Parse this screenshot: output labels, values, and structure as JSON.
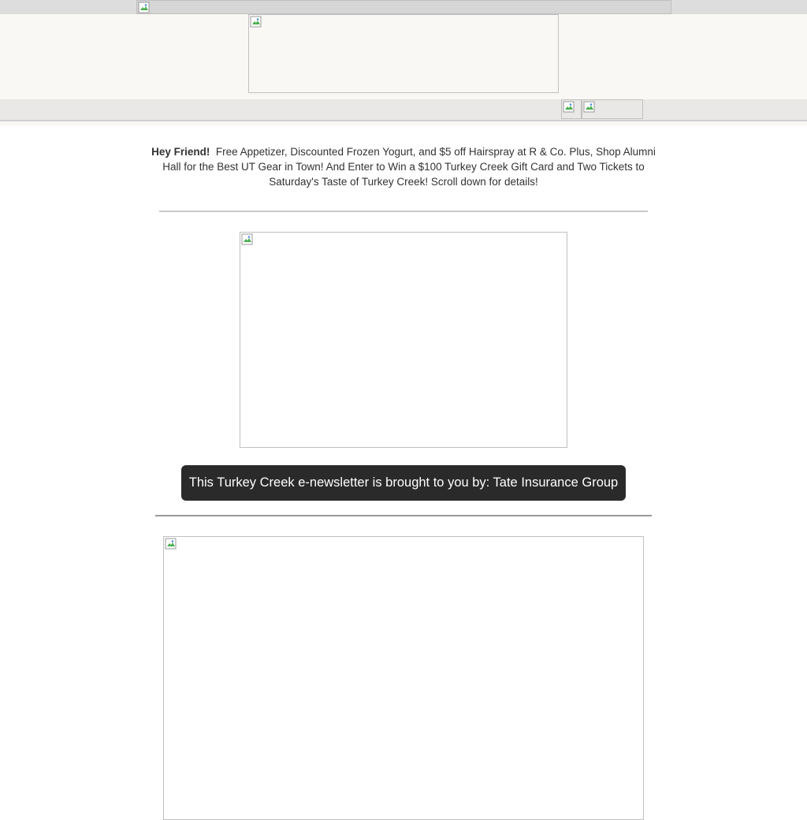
{
  "intro": {
    "greeting": "Hey Friend!",
    "message": "Free Appetizer, Discounted Frozen Yogurt, and $5 off  Hairspray at R & Co.  Plus, Shop Alumni Hall for the Best UT Gear in Town!  And Enter to Win a $100 Turkey Creek Gift Card and Two Tickets to Saturday's Taste of Turkey Creek!  Scroll down for details!"
  },
  "sponsor": {
    "text": "This Turkey Creek e-newsletter is brought to you by: Tate Insurance Group"
  },
  "colors": {
    "header_background": "#f9f8f4",
    "nav_background": "#e9e8e6",
    "sponsor_background": "#2a2a2a",
    "body_text": "#333333"
  },
  "icons": {
    "broken_image": "broken-image-icon"
  }
}
